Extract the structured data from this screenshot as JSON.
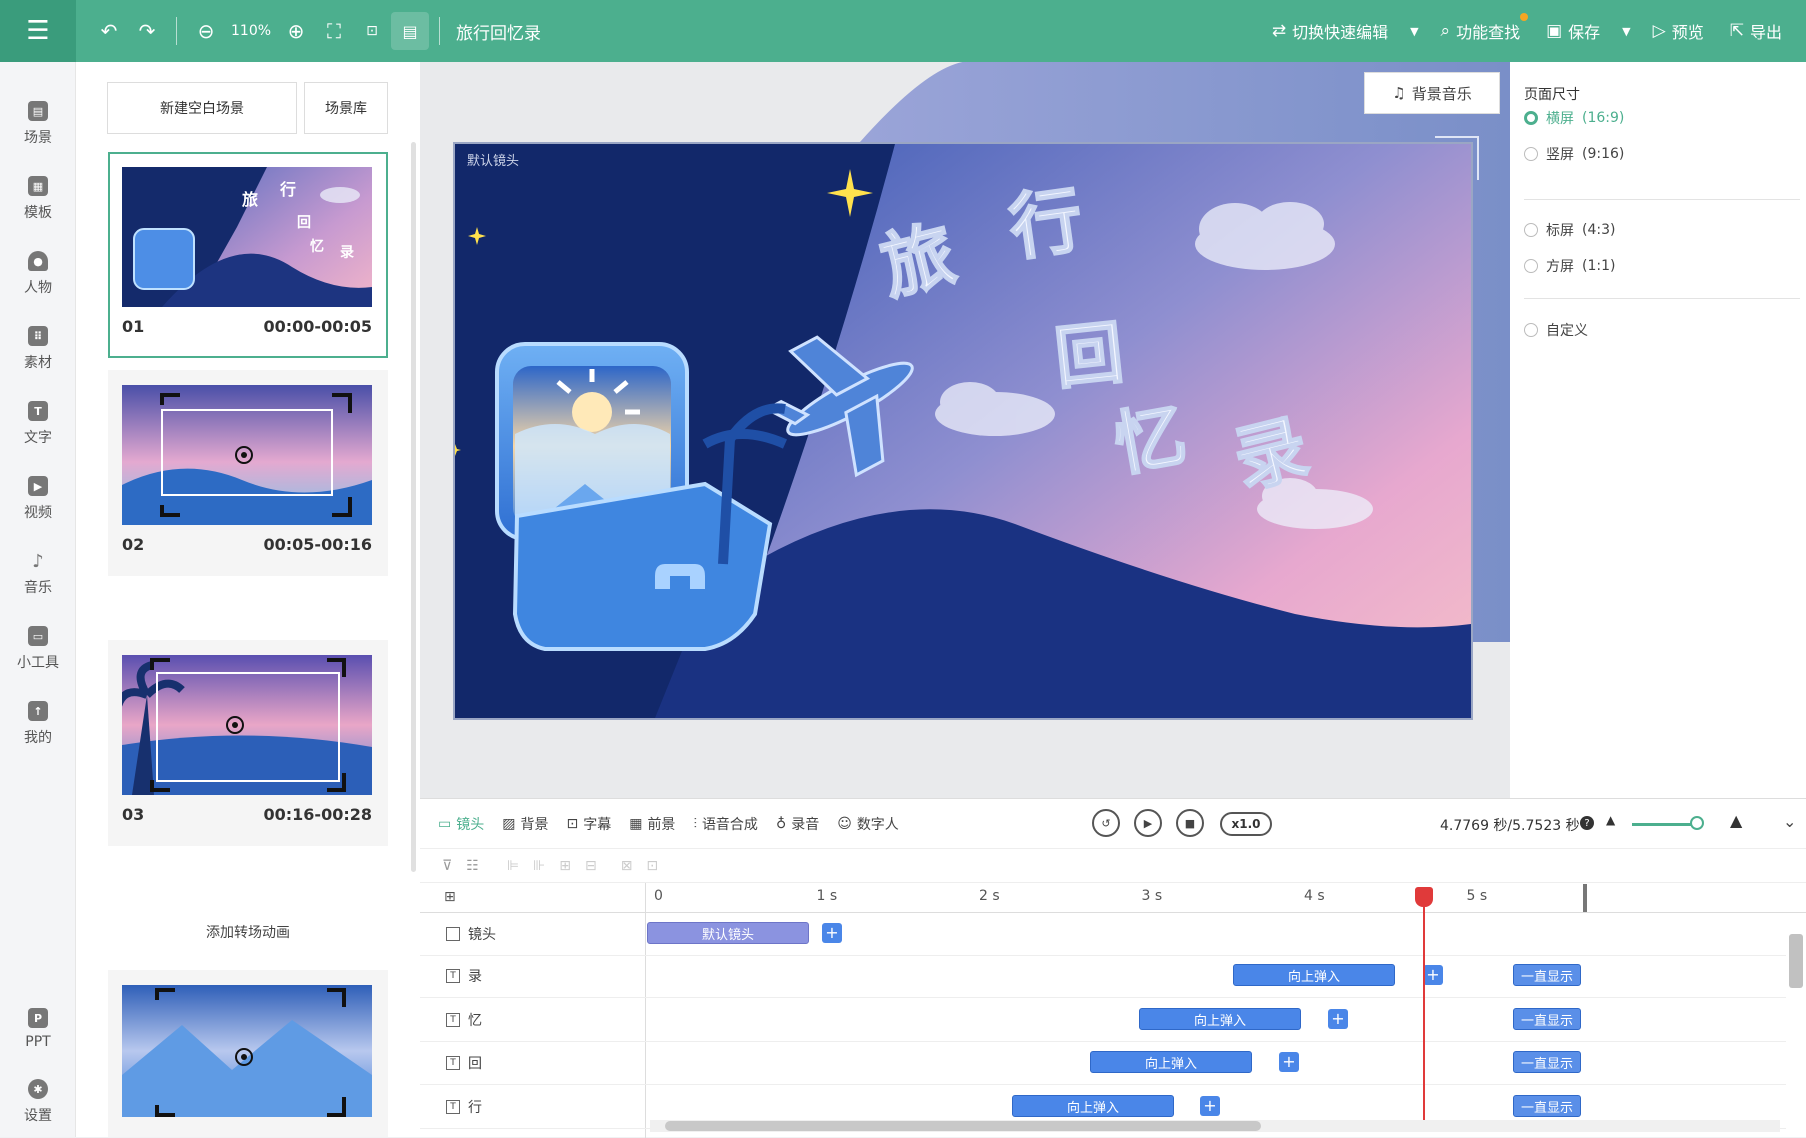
{
  "toolbar": {
    "menu_icon": "hamburger-icon",
    "zoom": "110%",
    "doc_title": "旅行回忆录",
    "actions": {
      "switch_label": "切换快速编辑",
      "feature_label": "功能查找",
      "save_label": "保存",
      "preview_label": "预览",
      "export_label": "导出"
    }
  },
  "nav": {
    "items": [
      {
        "label": "场景",
        "icon": "scene-icon"
      },
      {
        "label": "模板",
        "icon": "template-icon"
      },
      {
        "label": "人物",
        "icon": "person-icon"
      },
      {
        "label": "素材",
        "icon": "material-icon"
      },
      {
        "label": "文字",
        "icon": "text-icon"
      },
      {
        "label": "视频",
        "icon": "video-icon"
      },
      {
        "label": "音乐",
        "icon": "music-icon"
      },
      {
        "label": "小工具",
        "icon": "toolbox-icon"
      },
      {
        "label": "我的",
        "icon": "upload-icon"
      },
      {
        "label": "PPT",
        "icon": "ppt-icon"
      },
      {
        "label": "设置",
        "icon": "gear-icon"
      }
    ]
  },
  "scenes": {
    "new_blank": "新建空白场景",
    "library": "场景库",
    "transition": "添加转场动画",
    "items": [
      {
        "num": "01",
        "time": "00:00-00:05"
      },
      {
        "num": "02",
        "time": "00:05-00:16"
      },
      {
        "num": "03",
        "time": "00:16-00:28"
      }
    ]
  },
  "canvas": {
    "bg_music": "背景音乐",
    "camera_label": "默认镜头",
    "title_chars": [
      "旅",
      "行",
      "回",
      "忆",
      "录"
    ]
  },
  "props": {
    "title": "页面尺寸",
    "options": [
      {
        "label": "横屏",
        "ratio": "(16:9)",
        "selected": true
      },
      {
        "label": "竖屏",
        "ratio": "(9:16)",
        "selected": false
      },
      {
        "label": "标屏",
        "ratio": "(4:3)",
        "selected": false
      },
      {
        "label": "方屏",
        "ratio": "(1:1)",
        "selected": false
      },
      {
        "label": "自定义",
        "ratio": "",
        "selected": false
      }
    ]
  },
  "timeline": {
    "tabs": [
      "镜头",
      "背景",
      "字幕",
      "前景",
      "语音合成",
      "录音",
      "数字人"
    ],
    "speed": "x1.0",
    "time_readout": "4.7769 秒/5.7523 秒",
    "ruler": [
      "0",
      "1 s",
      "2 s",
      "3 s",
      "4 s",
      "5 s"
    ],
    "tracks": [
      {
        "name": "镜头",
        "clips": [
          {
            "label": "默认镜头"
          }
        ]
      },
      {
        "name": "录",
        "clips": [
          {
            "label": "向上弹入"
          },
          {
            "label": "一直显示"
          }
        ]
      },
      {
        "name": "忆",
        "clips": [
          {
            "label": "向上弹入"
          },
          {
            "label": "一直显示"
          }
        ]
      },
      {
        "name": "回",
        "clips": [
          {
            "label": "向上弹入"
          },
          {
            "label": "一直显示"
          }
        ]
      },
      {
        "name": "行",
        "clips": [
          {
            "label": "向上弹入"
          },
          {
            "label": "一直显示"
          }
        ]
      }
    ]
  },
  "colors": {
    "accent": "#4caf8e",
    "clip_blue": "#4a86e8",
    "playhead": "#e03a3a"
  }
}
